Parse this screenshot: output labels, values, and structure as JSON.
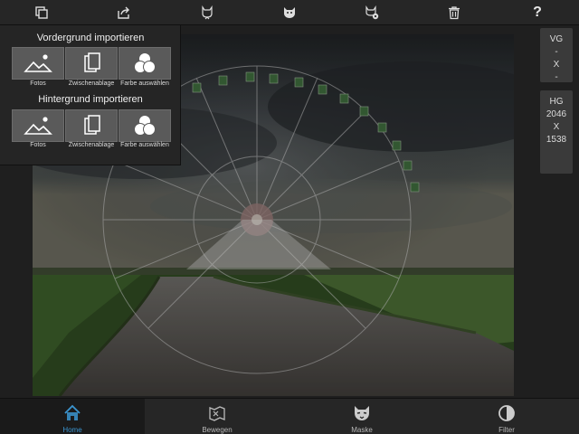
{
  "toolbar": {
    "icons": [
      "copy-layers-icon",
      "share-icon",
      "save-cat-icon",
      "cat-mask-icon",
      "cat-settings-icon",
      "trash-icon",
      "help-icon"
    ],
    "help_label": "?"
  },
  "import_panel": {
    "foreground_title": "Vordergrund importieren",
    "background_title": "Hintergrund importieren",
    "foreground_buttons": [
      {
        "label": "Fotos",
        "icon": "photos-icon"
      },
      {
        "label": "Zwischenablage",
        "icon": "clipboard-icon"
      },
      {
        "label": "Farbe auswählen",
        "icon": "color-picker-icon"
      }
    ],
    "background_buttons": [
      {
        "label": "Fotos",
        "icon": "photos-icon"
      },
      {
        "label": "Zwischenablage",
        "icon": "clipboard-icon"
      },
      {
        "label": "Farbe auswählen",
        "icon": "color-picker-icon"
      }
    ]
  },
  "right_panel": {
    "vg": {
      "label": "VG",
      "width": "-",
      "x": "X",
      "height": "-"
    },
    "hg": {
      "label": "HG",
      "width": "2046",
      "x": "X",
      "height": "1538"
    }
  },
  "bottom_nav": {
    "tabs": [
      {
        "label": "Home",
        "icon": "home-icon",
        "active": true
      },
      {
        "label": "Bewegen",
        "icon": "move-icon",
        "active": false
      },
      {
        "label": "Maske",
        "icon": "mask-icon",
        "active": false
      },
      {
        "label": "Filter",
        "icon": "filter-icon",
        "active": false
      }
    ]
  },
  "colors": {
    "accent": "#3b95d0",
    "toolbar_bg": "#262626",
    "panel_bg": "#252525",
    "button_bg": "#5a5a5a"
  }
}
